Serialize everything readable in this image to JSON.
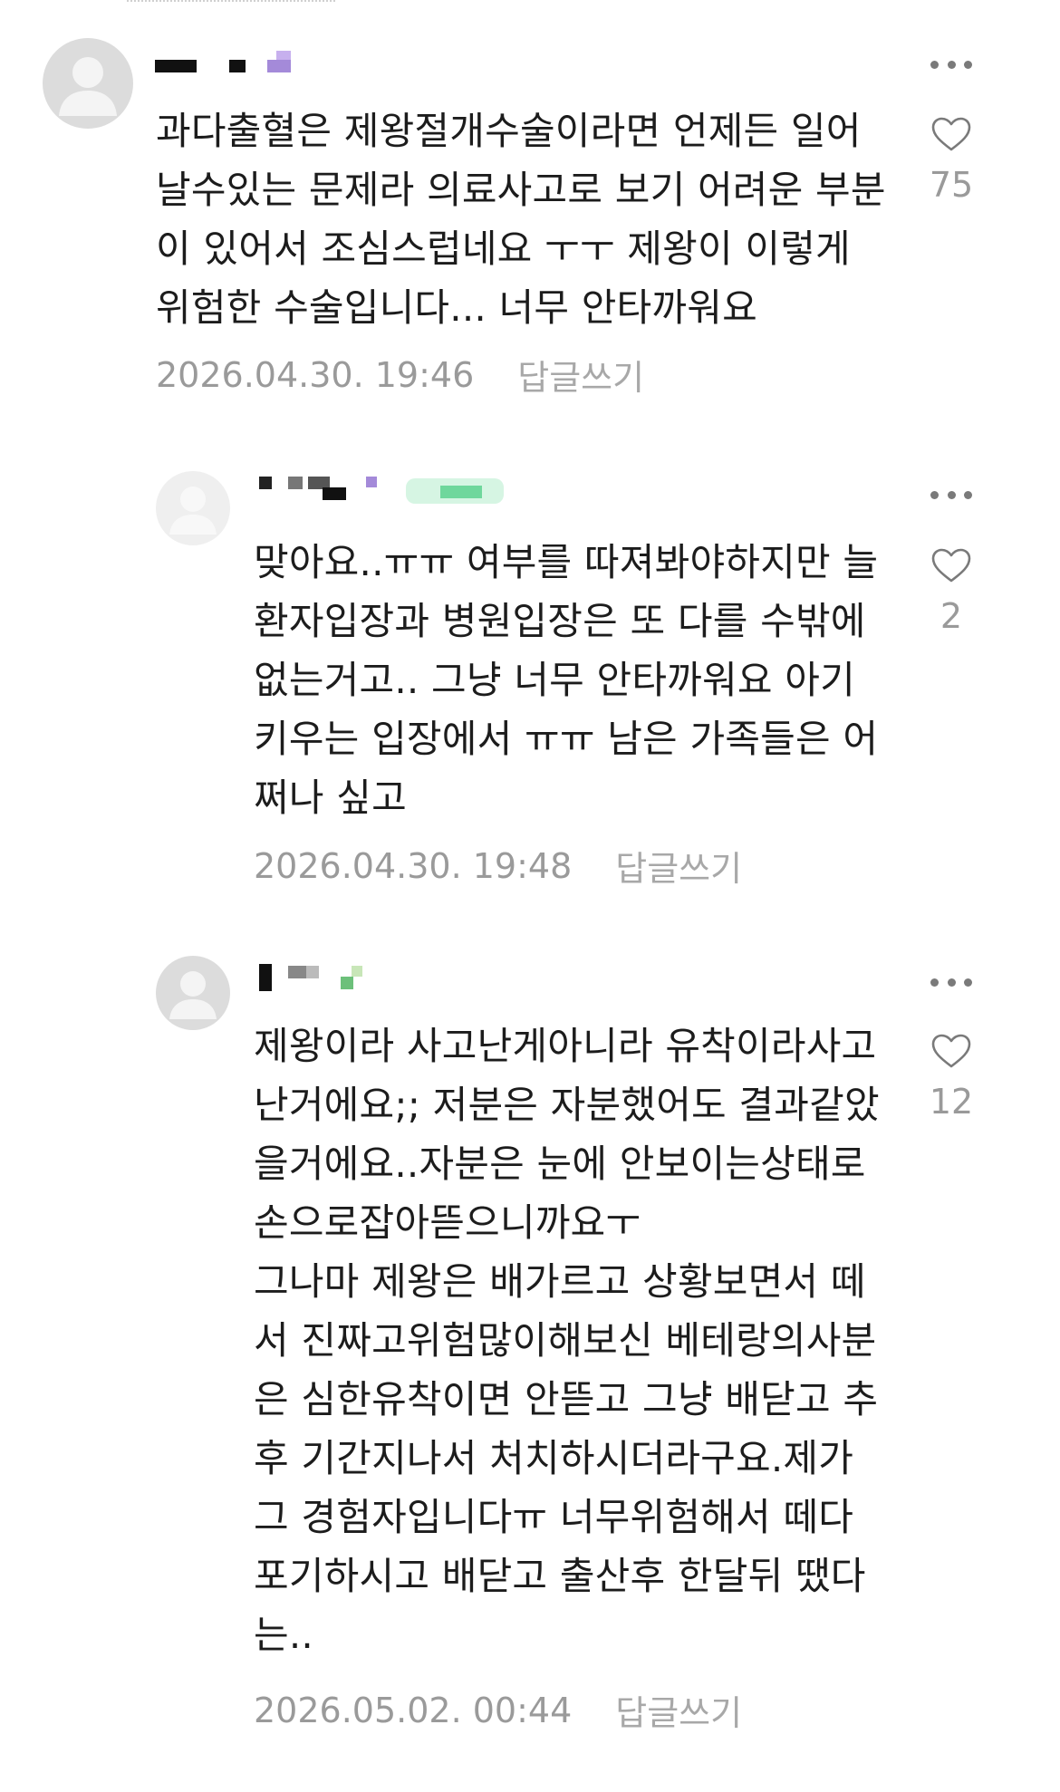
{
  "colors": {
    "text": "#1c1c1c",
    "meta": "#9a9a9a",
    "icon": "#7a7a7a",
    "avatar": "#dcdcdc"
  },
  "comments": [
    {
      "text": "과다출혈은 제왕절개수술이라면 언제든 일어\n날수있는 문제라 의료사고로 보기 어려운 부분\n이 있어서 조심스럽네요 ㅜㅜ 제왕이 이렇게\n위험한 수술입니다... 너무 안타까워요",
      "date": "2026.04.30. 19:46",
      "reply": "답글쓰기",
      "likes": "75",
      "icons": {
        "more": "more-dots-icon",
        "like": "heart-icon",
        "avatar": "user-icon"
      }
    },
    {
      "text": "맞아요..ㅠㅠ 여부를 따져봐야하지만 늘\n환자입장과 병원입장은 또 다를 수밖에\n없는거고.. 그냥 너무 안타까워요 아기\n키우는 입장에서 ㅠㅠ 남은 가족들은 어\n쩌나 싶고",
      "date": "2026.04.30. 19:48",
      "reply": "답글쓰기",
      "likes": "2",
      "icons": {
        "more": "more-dots-icon",
        "like": "heart-icon",
        "avatar": "user-icon"
      }
    },
    {
      "text": "제왕이라 사고난게아니라 유착이라사고\n난거에요;; 저분은 자분했어도 결과같았\n을거에요..자분은 눈에 안보이는상태로\n손으로잡아뜯으니까요ㅜ\n그나마 제왕은 배가르고 상황보면서 떼\n서 진짜고위험많이해보신 베테랑의사분\n은 심한유착이면 안뜯고 그냥 배닫고 추\n후 기간지나서 처치하시더라구요.제가\n그 경험자입니다ㅠ 너무위험해서 떼다\n포기하시고 배닫고 출산후 한달뒤 땠다\n는..",
      "date": "2026.05.02. 00:44",
      "reply": "답글쓰기",
      "likes": "12",
      "icons": {
        "more": "more-dots-icon",
        "like": "heart-icon",
        "avatar": "user-icon"
      }
    }
  ]
}
